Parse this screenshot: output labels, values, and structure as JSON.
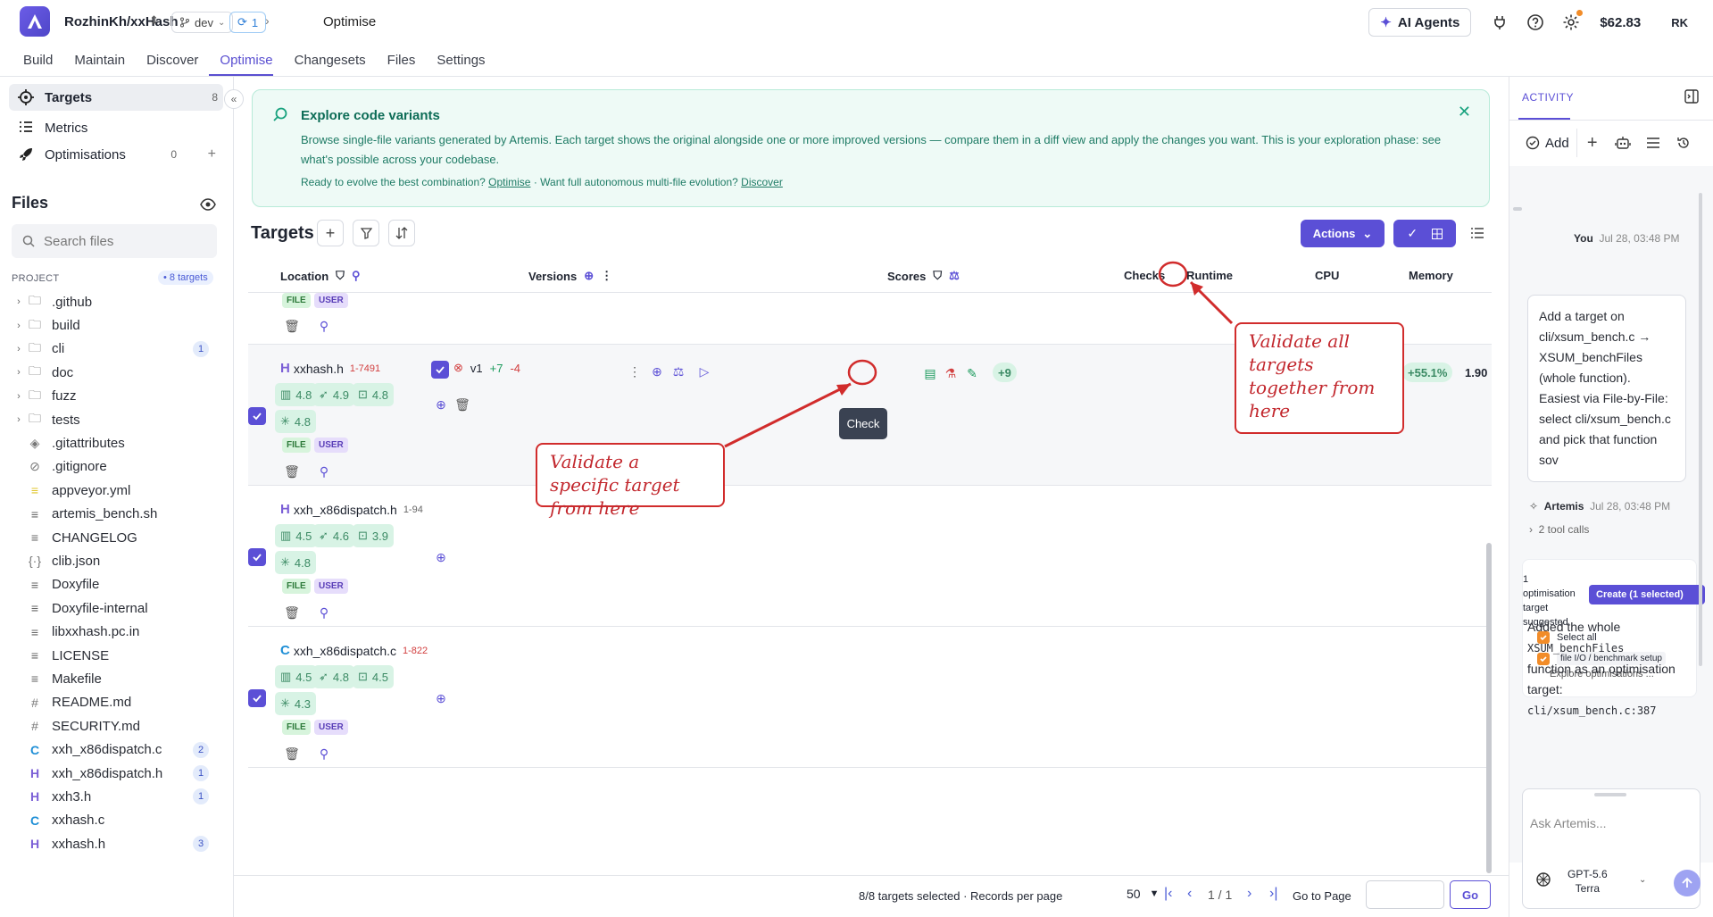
{
  "topbar": {
    "repo": "RozhinKh/xxHash",
    "branch": "dev",
    "sync_count": "1",
    "crumb": "Optimise",
    "ai_agents": "AI Agents",
    "credits": "$62.83",
    "initials": "RK"
  },
  "nav": {
    "tabs": [
      "Build",
      "Maintain",
      "Discover",
      "Optimise",
      "Changesets",
      "Files",
      "Settings"
    ],
    "active": "Optimise"
  },
  "sidebar": {
    "items": [
      {
        "label": "Targets",
        "count": "8"
      },
      {
        "label": "Metrics",
        "count": ""
      },
      {
        "label": "Optimisations",
        "count": "0"
      }
    ],
    "files_heading": "Files",
    "search_placeholder": "Search files",
    "project_label": "PROJECT",
    "targets_badge": "• 8 targets",
    "files": [
      {
        "name": ".github",
        "type": "folder",
        "badge": ""
      },
      {
        "name": "build",
        "type": "folder",
        "badge": ""
      },
      {
        "name": "cli",
        "type": "folder",
        "badge": "1"
      },
      {
        "name": "doc",
        "type": "folder",
        "badge": ""
      },
      {
        "name": "fuzz",
        "type": "folder",
        "badge": ""
      },
      {
        "name": "tests",
        "type": "folder",
        "badge": ""
      },
      {
        "name": ".gitattributes",
        "type": "diamond",
        "badge": ""
      },
      {
        "name": ".gitignore",
        "type": "ban",
        "badge": ""
      },
      {
        "name": "appveyor.yml",
        "type": "yml",
        "badge": ""
      },
      {
        "name": "artemis_bench.sh",
        "type": "lines",
        "badge": ""
      },
      {
        "name": "CHANGELOG",
        "type": "lines",
        "badge": ""
      },
      {
        "name": "clib.json",
        "type": "json",
        "badge": ""
      },
      {
        "name": "Doxyfile",
        "type": "lines",
        "badge": ""
      },
      {
        "name": "Doxyfile-internal",
        "type": "lines",
        "badge": ""
      },
      {
        "name": "libxxhash.pc.in",
        "type": "lines",
        "badge": ""
      },
      {
        "name": "LICENSE",
        "type": "lines",
        "badge": ""
      },
      {
        "name": "Makefile",
        "type": "lines",
        "badge": ""
      },
      {
        "name": "README.md",
        "type": "hash",
        "badge": ""
      },
      {
        "name": "SECURITY.md",
        "type": "hash",
        "badge": ""
      },
      {
        "name": "xxh_x86dispatch.c",
        "type": "c",
        "badge": "2"
      },
      {
        "name": "xxh_x86dispatch.h",
        "type": "h",
        "badge": "1"
      },
      {
        "name": "xxh3.h",
        "type": "h",
        "badge": "1"
      },
      {
        "name": "xxhash.c",
        "type": "c",
        "badge": ""
      },
      {
        "name": "xxhash.h",
        "type": "h",
        "badge": "3"
      }
    ]
  },
  "banner": {
    "title": "Explore code variants",
    "text": "Browse single-file variants generated by Artemis. Each target shows the original alongside one or more improved versions — compare them in a diff view and apply the changes you want. This is your exploration phase: see what's possible across your codebase.",
    "links_prefix": "Ready to evolve the best combination?",
    "link1": "Optimise",
    "links_mid": "· Want full autonomous multi-file evolution?",
    "link2": "Discover"
  },
  "targets": {
    "title": "Targets",
    "actions_label": "Actions",
    "columns": [
      "Location",
      "Versions",
      "Scores",
      "Checks",
      "Runtime",
      "CPU",
      "Memory"
    ],
    "rows": [
      {
        "lang": "H",
        "lang_color": "#7b5fd6",
        "name": "xxhash.h",
        "range": "1-7491",
        "scores": [
          "4.8",
          "4.9",
          "4.8",
          "4.8"
        ],
        "version": "v1",
        "added": "+7",
        "removed": "-4",
        "runtime": "+9",
        "memory_delta": "+55.1%",
        "memory_value": "1.90"
      },
      {
        "lang": "H",
        "lang_color": "#7b5fd6",
        "name": "xxh_x86dispatch.h",
        "range": "1-94",
        "scores": [
          "4.5",
          "4.6",
          "3.9",
          "4.8"
        ]
      },
      {
        "lang": "C",
        "lang_color": "#1f8fd6",
        "name": "xxh_x86dispatch.c",
        "range": "1-822",
        "scores": [
          "4.5",
          "4.8",
          "4.5",
          "4.3"
        ]
      }
    ],
    "tags": [
      "FILE",
      "USER"
    ],
    "tooltip": "Check"
  },
  "pager": {
    "summary": "8/8 targets selected · Records per page",
    "per_page": "50",
    "page": "1 / 1",
    "goto_label": "Go to Page",
    "go": "Go"
  },
  "annotations": {
    "specific": "Validate a specific target from here",
    "all": "Validate all targets together from here"
  },
  "activity": {
    "tab": "ACTIVITY",
    "add": "Add",
    "user_name": "You",
    "user_time": "Jul 28, 03:48 PM",
    "user_msg": "Add a target on cli/xsum_bench.c → XSUM_benchFiles (whole function). Easiest via File-by-File: select cli/xsum_bench.c and pick that function sov",
    "bot_name": "Artemis",
    "bot_time": "Jul 28, 03:48 PM",
    "tool_calls": "2 tool calls",
    "suggestion_count": "1",
    "suggestion_text": "optimisation target suggested",
    "create_label": "Create (1 selected)",
    "select_all": "Select all",
    "item_tag": "file I/O / benchmark setup",
    "item_desc": "Explore optimisations ...",
    "resp_1": "Added the whole",
    "resp_code": "XSUM_benchFiles",
    "resp_2": "function as an optimisation target:",
    "resp_code2": "cli/xsum_bench.c:387",
    "ask_placeholder": "Ask Artemis...",
    "model_line1": "GPT-5.6",
    "model_line2": "Terra"
  }
}
